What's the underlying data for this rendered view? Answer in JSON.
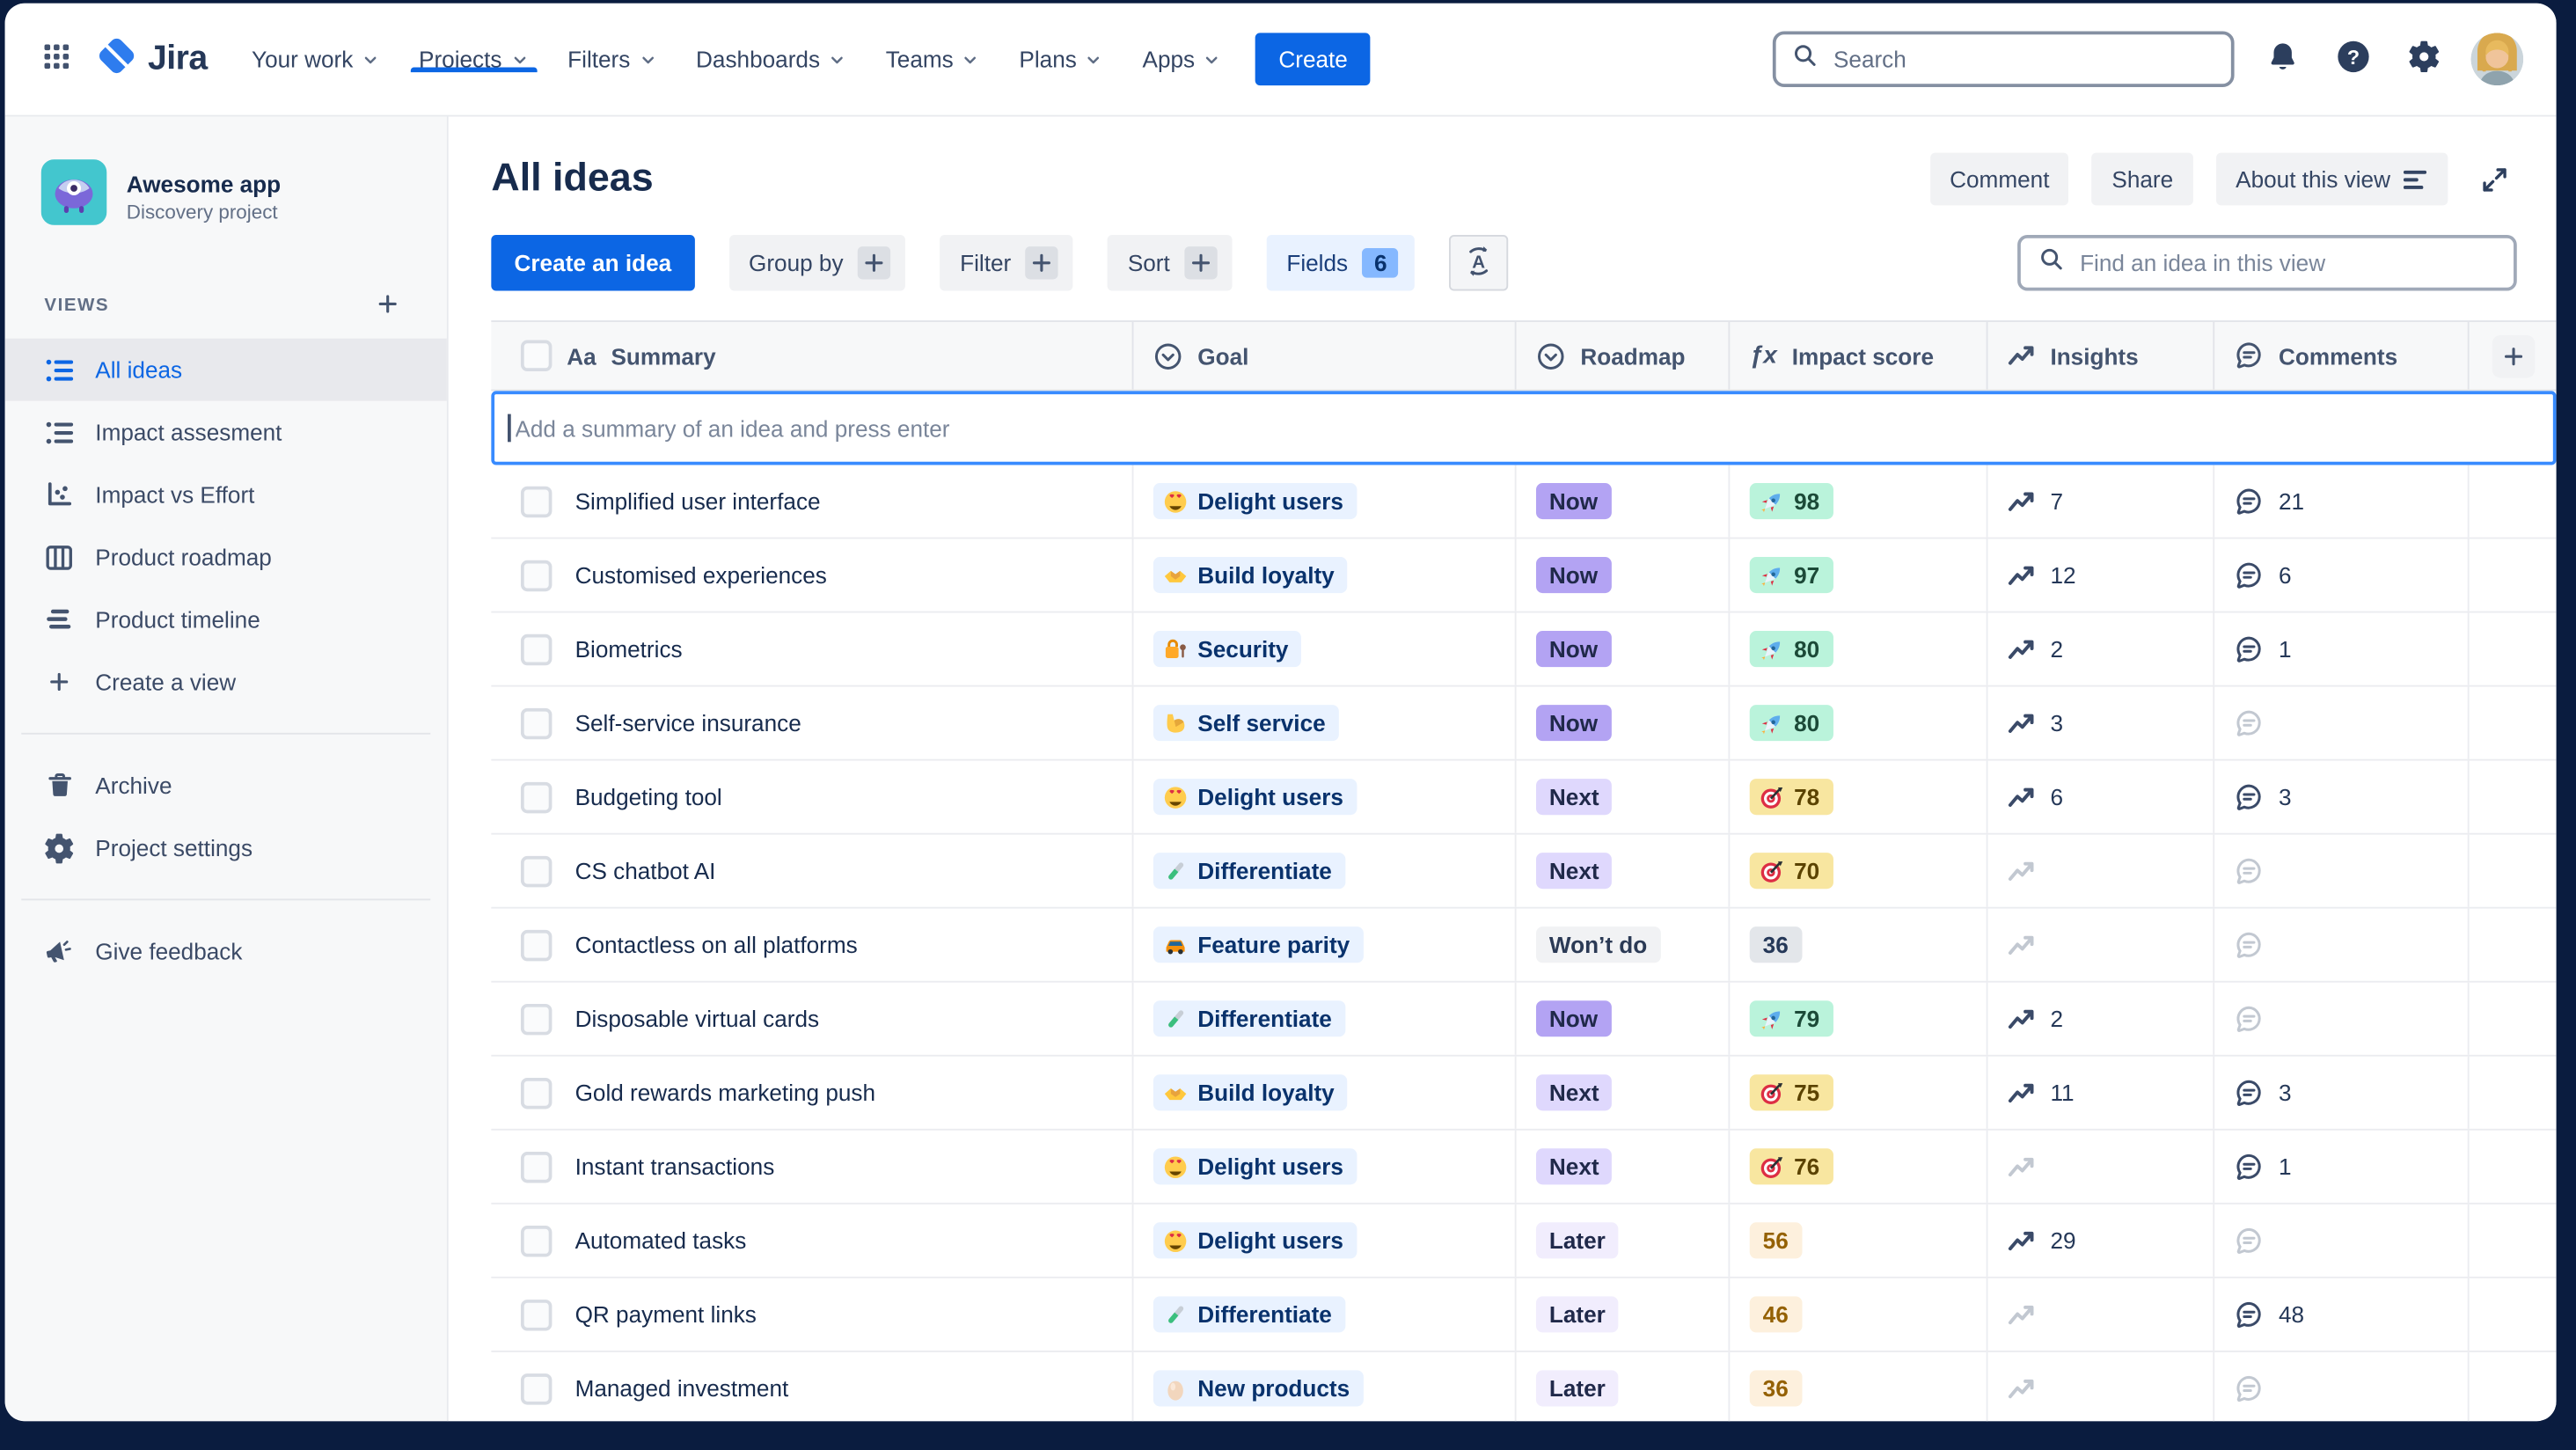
{
  "colors": {
    "page_bg": "#0A1C3F",
    "accent": "#0C66E4",
    "sidebar_bg": "#F7F8F9",
    "focus_blue": "#388BFF",
    "fields_bg": "#E9F2FF",
    "fields_badge": "#85B8FF",
    "goal_chip_bg": "#E9F2FF",
    "goal_chip_text": "#09326C",
    "roadmap_now": "#B3A3F3",
    "roadmap_next": "#DFD8FD",
    "roadmap_later": "#F1EDFD",
    "roadmap_wontdo": "#F1F2F4",
    "impact_green_bg": "#BAF3DB",
    "impact_green_text": "#1C4A38",
    "impact_yellow_bg": "#F8E6A0",
    "impact_yellow_text": "#5B4300",
    "impact_cream_bg": "#FDF0DD",
    "impact_cream_text": "#946104",
    "impact_gray_bg": "#E3E6EA"
  },
  "top_nav": {
    "app_name": "Jira",
    "menu": [
      {
        "label": "Your work"
      },
      {
        "label": "Projects",
        "active": true
      },
      {
        "label": "Filters"
      },
      {
        "label": "Dashboards"
      },
      {
        "label": "Teams"
      },
      {
        "label": "Plans"
      },
      {
        "label": "Apps"
      }
    ],
    "create_label": "Create",
    "search_placeholder": "Search",
    "action_icons": [
      {
        "icon": "bell",
        "name": "notifications"
      },
      {
        "icon": "help",
        "name": "help"
      },
      {
        "icon": "gear",
        "name": "settings"
      }
    ]
  },
  "sidebar": {
    "project_name": "Awesome app",
    "project_type": "Discovery project",
    "views_label": "VIEWS",
    "views": [
      {
        "icon": "list-view",
        "label": "All ideas",
        "active": true
      },
      {
        "icon": "list-view",
        "label": "Impact assesment"
      },
      {
        "icon": "scatter-chart",
        "label": "Impact vs Effort"
      },
      {
        "icon": "board",
        "label": "Product roadmap"
      },
      {
        "icon": "timeline",
        "label": "Product timeline"
      },
      {
        "icon": "plus",
        "label": "Create a view"
      }
    ],
    "secondary": [
      {
        "icon": "trash",
        "label": "Archive"
      },
      {
        "icon": "gear",
        "label": "Project settings"
      }
    ],
    "footer": [
      {
        "icon": "megaphone",
        "label": "Give feedback"
      }
    ]
  },
  "main": {
    "title": "All ideas",
    "header_buttons": [
      {
        "label": "Comment"
      },
      {
        "label": "Share"
      },
      {
        "label": "About this view",
        "icon": "align-lines"
      }
    ],
    "toolbar": {
      "create_label": "Create an idea",
      "group_buttons": [
        {
          "label": "Group by"
        },
        {
          "label": "Filter"
        },
        {
          "label": "Sort"
        }
      ],
      "fields_label": "Fields",
      "fields_count": "6",
      "find_placeholder": "Find an idea in this view"
    },
    "table": {
      "columns": [
        {
          "id": "summary",
          "icon": "aa",
          "label": "Summary"
        },
        {
          "id": "goal",
          "icon": "select",
          "label": "Goal"
        },
        {
          "id": "roadmap",
          "icon": "select",
          "label": "Roadmap"
        },
        {
          "id": "impact",
          "icon": "fx",
          "label": "Impact score"
        },
        {
          "id": "insights",
          "icon": "trend",
          "label": "Insights"
        },
        {
          "id": "comments",
          "icon": "comment",
          "label": "Comments"
        },
        {
          "id": "add-column",
          "icon": "plus",
          "label": ""
        }
      ],
      "add_placeholder": "Add a summary of an idea and press enter",
      "rows": [
        {
          "summary": "Simplified user interface",
          "goal": {
            "icon": "heart-eyes",
            "label": "Delight users"
          },
          "roadmap": {
            "label": "Now",
            "variant": "now"
          },
          "impact": {
            "icon": "rocket",
            "value": "98",
            "variant": "green"
          },
          "insights": "7",
          "comments": "21"
        },
        {
          "summary": "Customised experiences",
          "goal": {
            "icon": "handshake",
            "label": "Build loyalty"
          },
          "roadmap": {
            "label": "Now",
            "variant": "now"
          },
          "impact": {
            "icon": "rocket",
            "value": "97",
            "variant": "green"
          },
          "insights": "12",
          "comments": "6"
        },
        {
          "summary": "Biometrics",
          "goal": {
            "icon": "locked-with-key",
            "label": "Security"
          },
          "roadmap": {
            "label": "Now",
            "variant": "now"
          },
          "impact": {
            "icon": "rocket",
            "value": "80",
            "variant": "green"
          },
          "insights": "2",
          "comments": "1"
        },
        {
          "summary": "Self-service insurance",
          "goal": {
            "icon": "flexed-biceps",
            "label": "Self service"
          },
          "roadmap": {
            "label": "Now",
            "variant": "now"
          },
          "impact": {
            "icon": "rocket",
            "value": "80",
            "variant": "green"
          },
          "insights": "3",
          "comments": null
        },
        {
          "summary": "Budgeting tool",
          "goal": {
            "icon": "heart-eyes",
            "label": "Delight users"
          },
          "roadmap": {
            "label": "Next",
            "variant": "next"
          },
          "impact": {
            "icon": "target",
            "value": "78",
            "variant": "yellow"
          },
          "insights": "6",
          "comments": "3"
        },
        {
          "summary": "CS chatbot AI",
          "goal": {
            "icon": "test-tube",
            "label": "Differentiate"
          },
          "roadmap": {
            "label": "Next",
            "variant": "next"
          },
          "impact": {
            "icon": "target",
            "value": "70",
            "variant": "yellow"
          },
          "insights": null,
          "comments": null
        },
        {
          "summary": "Contactless on all platforms",
          "goal": {
            "icon": "taxi",
            "label": "Feature parity"
          },
          "roadmap": {
            "label": "Won’t do",
            "variant": "wontdo"
          },
          "impact": {
            "icon": null,
            "value": "36",
            "variant": "gray"
          },
          "insights": null,
          "comments": null
        },
        {
          "summary": "Disposable virtual cards",
          "goal": {
            "icon": "test-tube",
            "label": "Differentiate"
          },
          "roadmap": {
            "label": "Now",
            "variant": "now"
          },
          "impact": {
            "icon": "rocket",
            "value": "79",
            "variant": "green"
          },
          "insights": "2",
          "comments": null
        },
        {
          "summary": "Gold rewards marketing push",
          "goal": {
            "icon": "handshake",
            "label": "Build loyalty"
          },
          "roadmap": {
            "label": "Next",
            "variant": "next"
          },
          "impact": {
            "icon": "target",
            "value": "75",
            "variant": "yellow"
          },
          "insights": "11",
          "comments": "3"
        },
        {
          "summary": "Instant transactions",
          "goal": {
            "icon": "heart-eyes",
            "label": "Delight users"
          },
          "roadmap": {
            "label": "Next",
            "variant": "next"
          },
          "impact": {
            "icon": "target",
            "value": "76",
            "variant": "yellow"
          },
          "insights": null,
          "comments": "1"
        },
        {
          "summary": "Automated tasks",
          "goal": {
            "icon": "heart-eyes",
            "label": "Delight users"
          },
          "roadmap": {
            "label": "Later",
            "variant": "later"
          },
          "impact": {
            "icon": null,
            "value": "56",
            "variant": "cream"
          },
          "insights": "29",
          "comments": null
        },
        {
          "summary": "QR payment links",
          "goal": {
            "icon": "test-tube",
            "label": "Differentiate"
          },
          "roadmap": {
            "label": "Later",
            "variant": "later"
          },
          "impact": {
            "icon": null,
            "value": "46",
            "variant": "cream"
          },
          "insights": null,
          "comments": "48"
        },
        {
          "summary": "Managed investment",
          "goal": {
            "icon": "egg",
            "label": "New products"
          },
          "roadmap": {
            "label": "Later",
            "variant": "later"
          },
          "impact": {
            "icon": null,
            "value": "36",
            "variant": "cream"
          },
          "insights": null,
          "comments": null
        }
      ]
    }
  }
}
